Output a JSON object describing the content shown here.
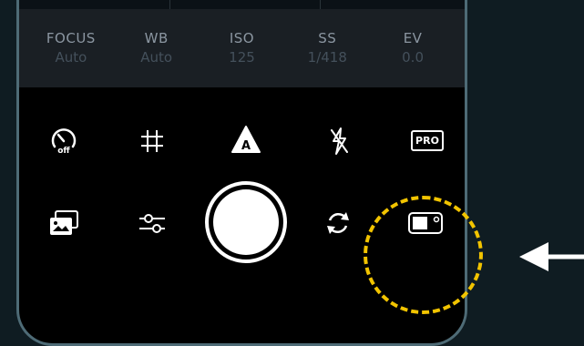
{
  "params": [
    {
      "label": "FOCUS",
      "value": "Auto"
    },
    {
      "label": "WB",
      "value": "Auto"
    },
    {
      "label": "ISO",
      "value": "125"
    },
    {
      "label": "SS",
      "value": "1/418"
    },
    {
      "label": "EV",
      "value": "0.0"
    }
  ],
  "toolbar": {
    "pro_label": "PRO"
  },
  "colors": {
    "highlight": "#f2c400",
    "phone_border": "#4e6b76",
    "background": "#0f1c22"
  },
  "icons": [
    "timer-off-icon",
    "grid-icon",
    "auto-mode-icon",
    "flash-off-icon",
    "pro-mode-icon",
    "gallery-icon",
    "settings-sliders-icon",
    "shutter-button",
    "switch-camera-icon",
    "camera-mode-icon",
    "pointer-arrow-icon"
  ]
}
